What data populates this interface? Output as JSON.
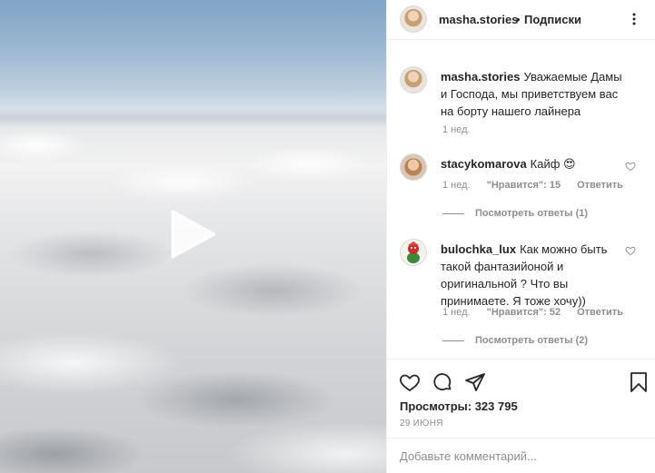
{
  "post": {
    "author": "masha.stories",
    "separator": "•",
    "follow_status": "Подписки"
  },
  "caption": {
    "username": "masha.stories",
    "text": "Уважаемые Дамы и Господа, мы приветствуем вас на борту нашего лайнера",
    "time": "1 нед."
  },
  "comments": [
    {
      "username": "stacykomarova",
      "text": "Кайф 😍",
      "time": "1 нед.",
      "likes": "\"Нравится\": 15",
      "reply": "Ответить",
      "view_replies": "Посмотреть ответы (1)"
    },
    {
      "username": "bulochka_lux",
      "text": "Как можно быть такой фантазийоной и оригинальной ? Что вы принимаете. Я тоже хочу))",
      "time": "1 нед.",
      "likes": "\"Нравится\": 52",
      "reply": "Ответить",
      "view_replies": "Посмотреть ответы (2)"
    }
  ],
  "stats": {
    "views": "Просмотры: 323 795",
    "date": "29 ИЮНЯ"
  },
  "add_comment": {
    "placeholder": "Добавьте комментарий..."
  },
  "icons": {
    "play": "play-icon",
    "more": "more-icon",
    "like": "heart-icon",
    "comment": "comment-icon",
    "share": "share-icon",
    "save": "bookmark-icon"
  },
  "colors": {
    "text": "#262626",
    "secondary": "#8e8e8e",
    "border": "#efefef"
  }
}
